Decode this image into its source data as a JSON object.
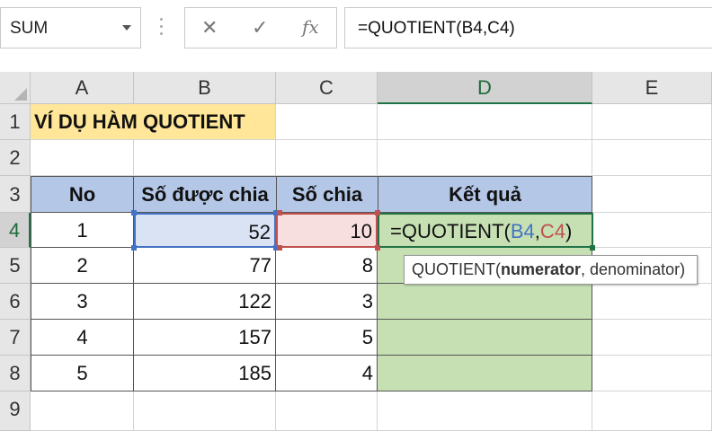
{
  "name_box": {
    "value": "SUM"
  },
  "formula_toolbar": {
    "cancel_icon": "✕",
    "enter_icon": "✓",
    "fx_icon": "fx"
  },
  "formula_bar": {
    "value": "=QUOTIENT(B4,C4)"
  },
  "columns": [
    "A",
    "B",
    "C",
    "D",
    "E"
  ],
  "rows": [
    "1",
    "2",
    "3",
    "4",
    "5",
    "6",
    "7",
    "8",
    "9"
  ],
  "sheet": {
    "title": "VÍ DỤ HÀM QUOTIENT",
    "headers": {
      "no": "No",
      "dividend": "Số được chia",
      "divisor": "Số chia",
      "result": "Kết quả"
    },
    "data": [
      {
        "no": "1",
        "dividend": "52",
        "divisor": "10"
      },
      {
        "no": "2",
        "dividend": "77",
        "divisor": "8"
      },
      {
        "no": "3",
        "dividend": "122",
        "divisor": "3"
      },
      {
        "no": "4",
        "dividend": "157",
        "divisor": "5"
      },
      {
        "no": "5",
        "dividend": "185",
        "divisor": "4"
      }
    ],
    "active_cell_formula": {
      "prefix": "=QUOTIENT(",
      "arg1": "B4",
      "sep": ",",
      "arg2": "C4",
      "suffix": ")"
    }
  },
  "tooltip": {
    "func": "QUOTIENT(",
    "arg_bold": "numerator",
    "rest": ", denominator)"
  },
  "colors": {
    "ref1": "#4472c4",
    "ref2": "#c0504d",
    "selection": "#217346",
    "header_fill": "#b4c7e7",
    "result_fill": "#c6e0b4",
    "title_fill": "#ffe699"
  }
}
